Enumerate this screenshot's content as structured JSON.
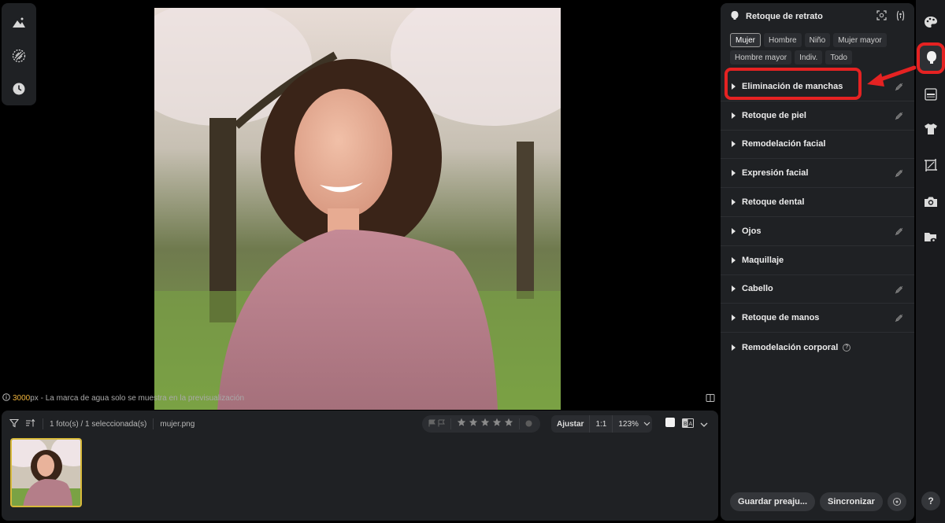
{
  "left_tools": [
    {
      "name": "landscape-tool-icon"
    },
    {
      "name": "texture-tool-icon"
    },
    {
      "name": "history-icon"
    }
  ],
  "info": {
    "size": "3000",
    "unit": "px",
    "text": " - La marca de agua solo se muestra en la previsualización"
  },
  "filmstrip": {
    "count_text": "1 foto(s) / 1 seleccionada(s)",
    "filename": "mujer.png",
    "zoom": {
      "fit": "Ajustar",
      "one_to_one": "1:1",
      "level": "123%"
    },
    "stars": 5
  },
  "panel": {
    "title": "Retoque de retrato",
    "chips": [
      "Mujer",
      "Hombre",
      "Niño",
      "Mujer mayor",
      "Hombre mayor",
      "Indiv.",
      "Todo"
    ],
    "active_chip": "Mujer",
    "sections": [
      {
        "label": "Eliminación de manchas",
        "edited": true
      },
      {
        "label": "Retoque de piel",
        "edited": true
      },
      {
        "label": "Remodelación facial",
        "edited": false
      },
      {
        "label": "Expresión facial",
        "edited": true
      },
      {
        "label": "Retoque dental",
        "edited": false
      },
      {
        "label": "Ojos",
        "edited": true
      },
      {
        "label": "Maquillaje",
        "edited": false
      },
      {
        "label": "Cabello",
        "edited": true
      },
      {
        "label": "Retoque de manos",
        "edited": true
      },
      {
        "label": "Remodelación corporal",
        "edited": false
      }
    ],
    "save_preset": "Guardar preaju...",
    "sync": "Sincronizar"
  },
  "right_rail": [
    "palette-icon",
    "face-icon",
    "gradient-icon",
    "shirt-icon",
    "crop-icon",
    "camera-icon",
    "folder-eye-icon"
  ],
  "help_label": "?",
  "colors": {
    "accent_red": "#e52222",
    "thumb_border": "#d7b93a",
    "px_highlight": "#f0b43c"
  }
}
